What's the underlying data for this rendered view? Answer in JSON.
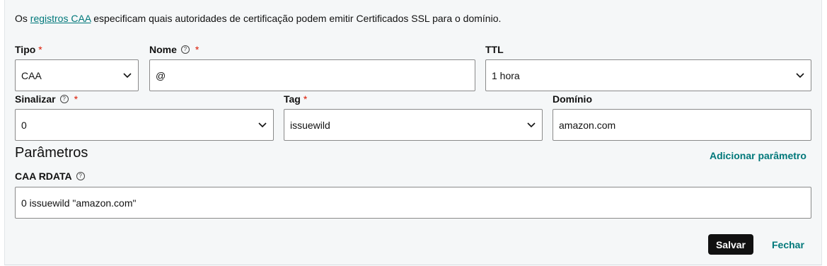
{
  "intro": {
    "prefix": "Os ",
    "link": "registros CAA",
    "suffix": " especificam quais autoridades de certificação podem emitir Certificados SSL para o domínio."
  },
  "fields": {
    "tipo": {
      "label": "Tipo",
      "required": "*",
      "value": "CAA"
    },
    "nome": {
      "label": "Nome",
      "required": "*",
      "value": "@"
    },
    "ttl": {
      "label": "TTL",
      "value": "1 hora"
    },
    "sinalizar": {
      "label": "Sinalizar",
      "required": "*",
      "value": "0"
    },
    "tag": {
      "label": "Tag",
      "required": "*",
      "value": "issuewild"
    },
    "dominio": {
      "label": "Domínio",
      "value": "amazon.com"
    }
  },
  "parametros": {
    "title": "Parâmetros",
    "add_label": "Adicionar parâmetro"
  },
  "rdata": {
    "label": "CAA RDATA",
    "value": "0 issuewild \"amazon.com\""
  },
  "actions": {
    "save_label": "Salvar",
    "close_label": "Fechar"
  },
  "icons": {
    "help": "?"
  },
  "colors": {
    "link": "#00787a",
    "required": "#db1802",
    "primary_button": "#111111"
  }
}
